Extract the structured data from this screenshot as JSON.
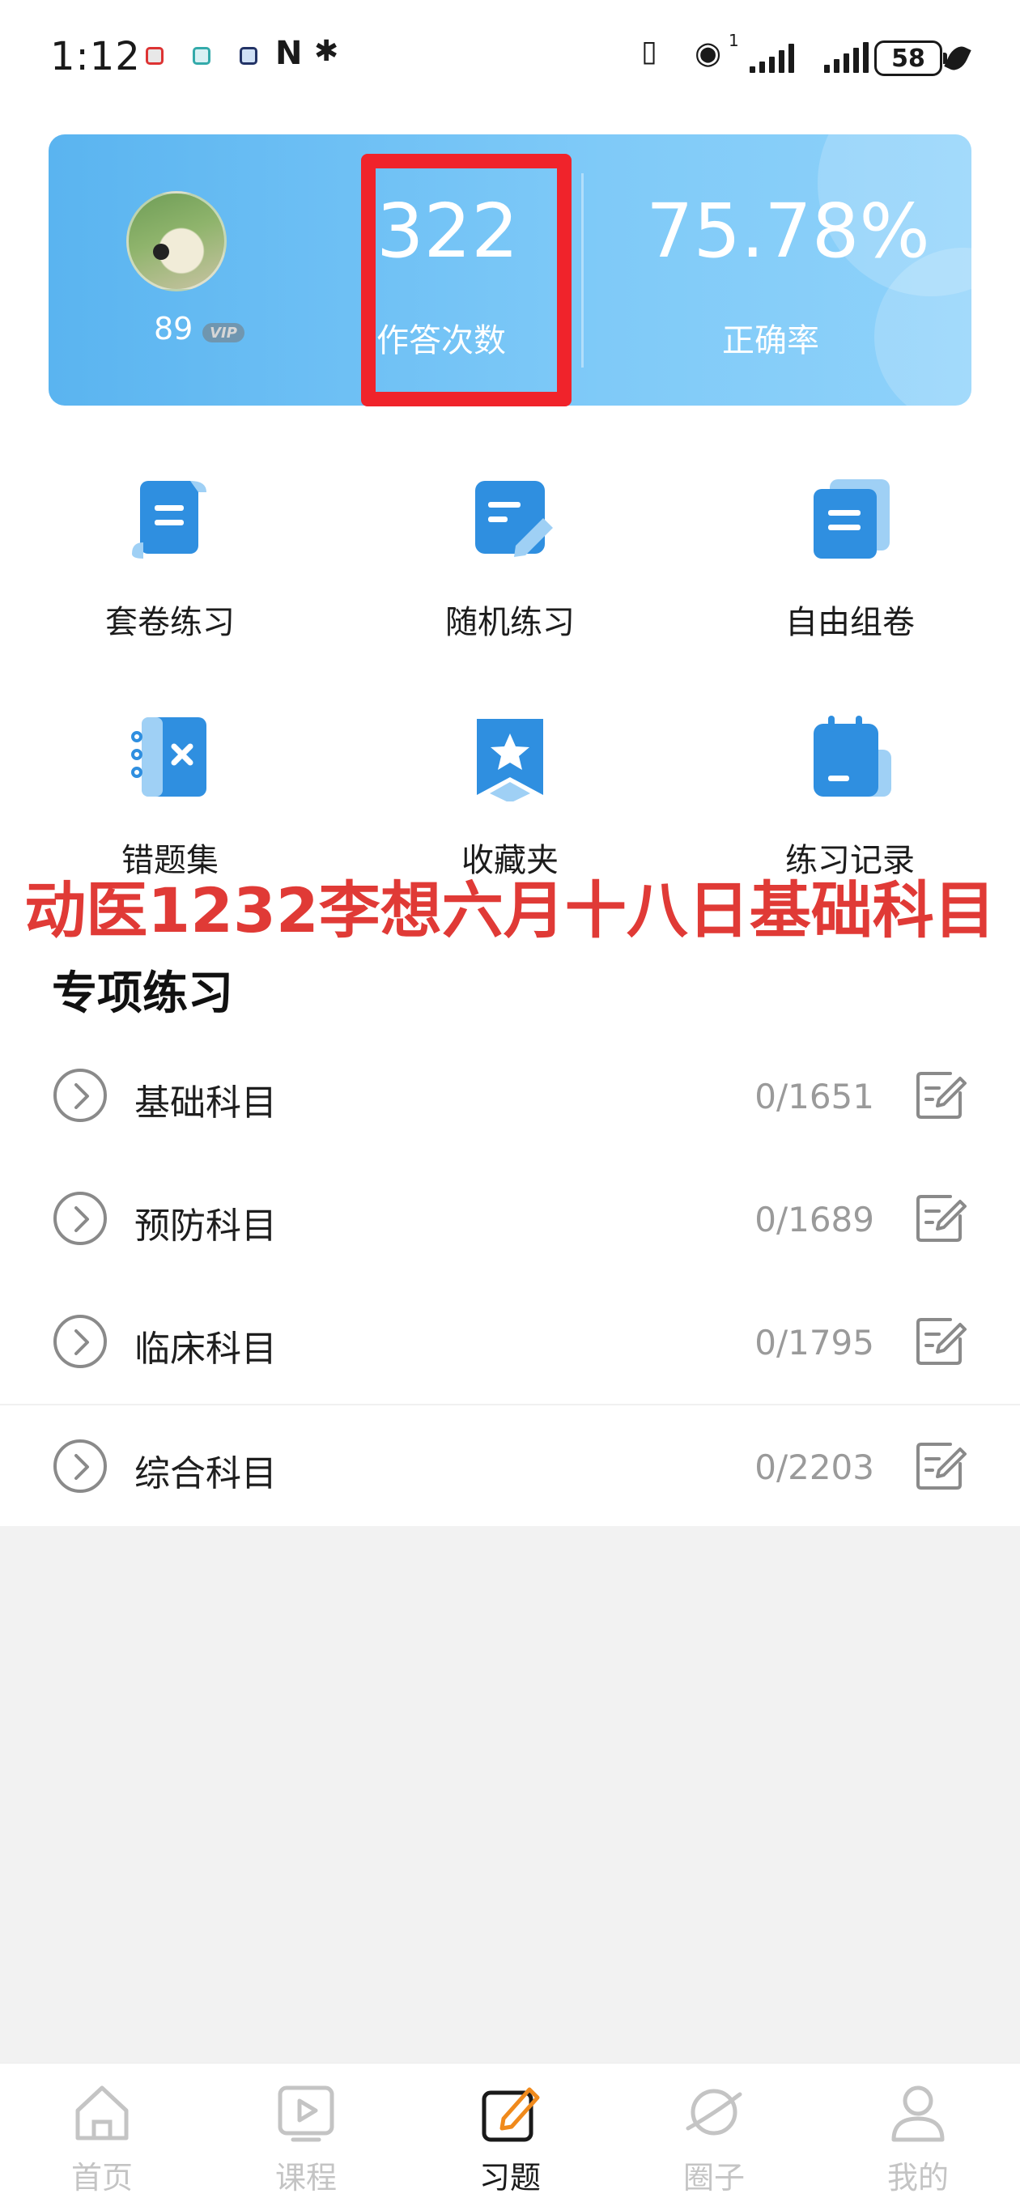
{
  "status_bar": {
    "time": "1:12",
    "battery": "58",
    "network_superscript": "1"
  },
  "stats_card": {
    "level": "89",
    "vip_badge": "VIP",
    "attempts_value": "322",
    "attempts_label": "作答次数",
    "accuracy_value": "75.78%",
    "accuracy_label": "正确率"
  },
  "features": [
    {
      "label": "套卷练习",
      "icon": "scroll-paper-icon"
    },
    {
      "label": "随机练习",
      "icon": "edit-paper-icon"
    },
    {
      "label": "自由组卷",
      "icon": "stacked-papers-icon"
    },
    {
      "label": "错题集",
      "icon": "wrong-notebook-icon"
    },
    {
      "label": "收藏夹",
      "icon": "star-bookmark-icon"
    },
    {
      "label": "练习记录",
      "icon": "notepad-icon"
    }
  ],
  "overlay_annotation": "动医1232李想六月十八日基础科目",
  "section": {
    "title": "专项练习",
    "subjects": [
      {
        "name": "基础科目",
        "progress": "0/1651"
      },
      {
        "name": "预防科目",
        "progress": "0/1689"
      },
      {
        "name": "临床科目",
        "progress": "0/1795"
      },
      {
        "name": "综合科目",
        "progress": "0/2203"
      }
    ]
  },
  "bottom_nav": [
    {
      "label": "首页",
      "icon": "home-icon",
      "active": false
    },
    {
      "label": "课程",
      "icon": "play-course-icon",
      "active": false
    },
    {
      "label": "习题",
      "icon": "edit-exercise-icon",
      "active": true
    },
    {
      "label": "圈子",
      "icon": "planet-icon",
      "active": false
    },
    {
      "label": "我的",
      "icon": "profile-icon",
      "active": false
    }
  ],
  "colors": {
    "card_gradient_start": "#5ab4f0",
    "card_gradient_end": "#8fd2fa",
    "icon_blue": "#2f8fe0",
    "highlight_red": "#f0232b",
    "annotation_red": "#e03a36",
    "active_accent": "#f08a1c"
  }
}
